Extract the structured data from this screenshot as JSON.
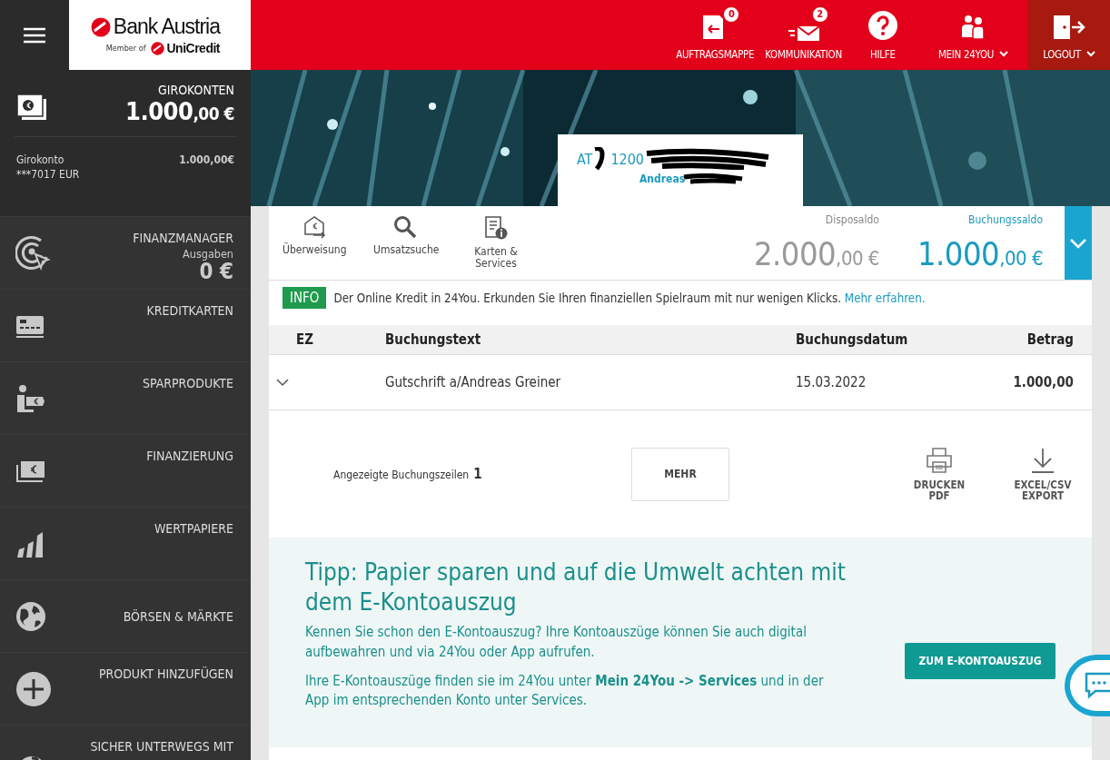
{
  "header": {
    "logo": {
      "name": "Bank Austria",
      "member": "Member of",
      "group": "UniCredit"
    },
    "actions": [
      {
        "kind": "folder",
        "label": "AUFTRAGSMAPPE",
        "badge": "0",
        "dropdown": false
      },
      {
        "kind": "mail",
        "label": "KOMMUNIKATION",
        "badge": "2",
        "dropdown": false
      },
      {
        "kind": "help",
        "label": "HILFE",
        "dropdown": false
      },
      {
        "kind": "people",
        "label": "MEIN 24YOU",
        "dropdown": true
      },
      {
        "kind": "logout",
        "label": "LOGOUT",
        "dropdown": true
      }
    ]
  },
  "sidebar": {
    "accounts": {
      "title": "GIROKONTEN",
      "amount": "1.000",
      "decimals": ",00 €",
      "rows": [
        {
          "name": "Girokonto",
          "number": "***7017 EUR",
          "amount": "1.000,00€"
        }
      ]
    },
    "items": [
      {
        "kind": "target",
        "label": "FINANZMANAGER",
        "sub": "Ausgaben",
        "value": "0 €"
      },
      {
        "kind": "card",
        "label": "KREDITKARTEN"
      },
      {
        "kind": "saving",
        "label": "SPARPRODUKTE"
      },
      {
        "kind": "money",
        "label": "FINANZIERUNG"
      },
      {
        "kind": "chart",
        "label": "WERTPAPIERE"
      },
      {
        "kind": "globe",
        "label": "BÖRSEN & MÄRKTE"
      },
      {
        "kind": "plus",
        "label": "PRODUKT HINZUFÜGEN"
      },
      {
        "kind": "plane",
        "label": "SICHER UNTERWEGS MIT"
      }
    ]
  },
  "account": {
    "iban_start": "AT",
    "iban_middle": "1200",
    "holder": "Andreas"
  },
  "quick_actions": [
    {
      "kind": "transfer",
      "label": "Überweisung"
    },
    {
      "kind": "search",
      "label": "Umsatzsuche"
    },
    {
      "kind": "cards",
      "label": "Karten & Services"
    }
  ],
  "balances": [
    {
      "kind": "dispo",
      "label": "Disposaldo",
      "amount": "2.000",
      "decimals": ",00 €"
    },
    {
      "kind": "booking",
      "label": "Buchungssaldo",
      "amount": "1.000",
      "decimals": ",00 €"
    }
  ],
  "info": {
    "tag": "INFO",
    "text": "Der Online Kredit in 24You. Erkunden Sie Ihren finanziellen Spielraum mit nur wenigen Klicks.",
    "link": "Mehr erfahren."
  },
  "table": {
    "columns": [
      "EZ",
      "Buchungstext",
      "Buchungsdatum",
      "Betrag"
    ],
    "rows": [
      {
        "expanded": false,
        "text": "Gutschrift a/Andreas Greiner",
        "date": "15.03.2022",
        "amount": "1.000,00"
      }
    ]
  },
  "footer": {
    "count_label": "Angezeigte Buchungszeilen",
    "count": "1",
    "more": "MEHR",
    "actions": [
      {
        "kind": "print",
        "label": "DRUCKEN PDF"
      },
      {
        "kind": "download",
        "label": "EXCEL/CSV EXPORT"
      }
    ]
  },
  "tip": {
    "title": "Tipp: Papier sparen und auf die Umwelt achten mit dem E-Kontoauszug",
    "paragraphs": [
      "Kennen Sie schon den E-Kontoauszug? Ihre Kontoauszüge können Sie auch digital aufbewahren und via 24You oder App aufrufen.",
      "Ihre E-Kontoauszüge finden sie im 24You unter **Mein 24You -> Services** und in der App im entsprechenden Konto unter Services."
    ],
    "button": "ZUM E-KONTOAUSZUG"
  }
}
